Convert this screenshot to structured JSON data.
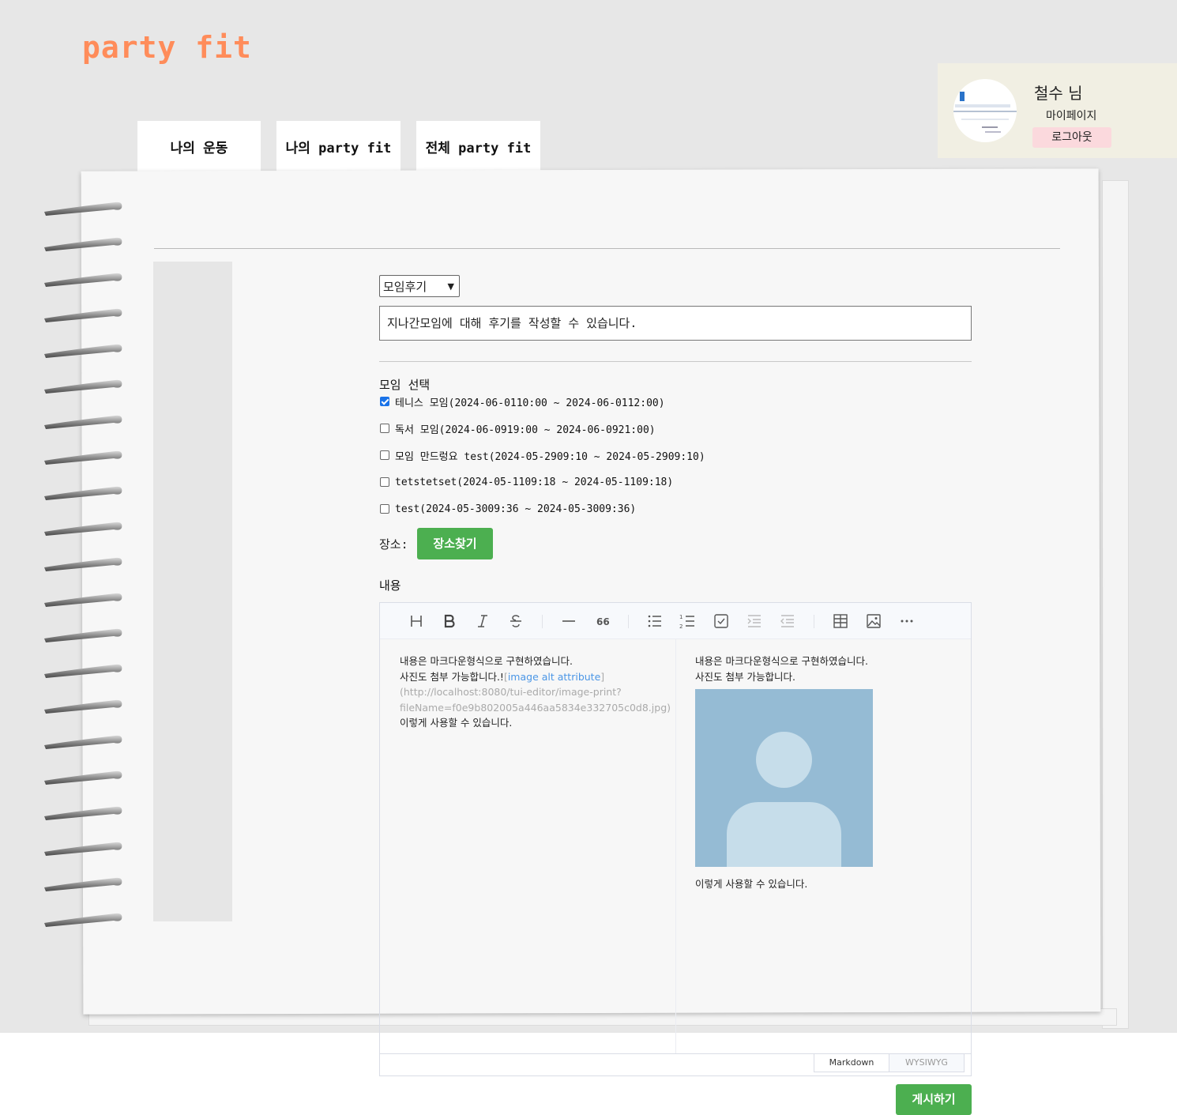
{
  "brand": {
    "logo": "party fit",
    "accent_color": "#ff8c5a"
  },
  "profile": {
    "name": "철수 님",
    "mypage_label": "마이페이지",
    "logout_label": "로그아웃"
  },
  "tabs": [
    {
      "label": "나의 운동"
    },
    {
      "label": "나의 party fit"
    },
    {
      "label": "전체 party fit"
    }
  ],
  "form": {
    "category": {
      "selected": "모임후기"
    },
    "title_value": "지나간모임에 대해 후기를 작성할 수 있습니다.",
    "meeting_select_label": "모임 선택",
    "meetings": [
      {
        "label": "테니스 모임(2024-06-0110:00 ~ 2024-06-0112:00)",
        "checked": true
      },
      {
        "label": "독서 모임(2024-06-0919:00 ~ 2024-06-0921:00)",
        "checked": false
      },
      {
        "label": "모임 만드렁요 test(2024-05-2909:10 ~ 2024-05-2909:10)",
        "checked": false
      },
      {
        "label": "tetstetset(2024-05-1109:18 ~ 2024-05-1109:18)",
        "checked": false
      },
      {
        "label": "test(2024-05-3009:36 ~ 2024-05-3009:36)",
        "checked": false
      }
    ],
    "place_label": "장소:",
    "place_button": "장소찾기",
    "content_label": "내용",
    "submit_button": "게시하기"
  },
  "editor": {
    "toolbar_icons": [
      "heading-icon",
      "bold-icon",
      "italic-icon",
      "strike-icon",
      "hr-icon",
      "quote-icon",
      "bullet-list-icon",
      "ordered-list-icon",
      "task-list-icon",
      "indent-icon",
      "outdent-icon",
      "table-icon",
      "image-icon",
      "more-icon"
    ],
    "markdown": {
      "line1": "내용은 마크다운형식으로 구현하였습니다.",
      "line2_text": "사진도 첨부 가능합니다.!",
      "open_bracket": "[",
      "alt_text": "image alt attribute",
      "close_bracket": "]",
      "url_line1": "(http://localhost:8080/tui-editor/image-print?",
      "url_line2": "fileName=f0e9b802005a446aa5834e332705c0d8.jpg)",
      "line_last": "이렇게 사용할 수 있습니다."
    },
    "preview": {
      "line1": "내용은 마크다운형식으로 구현하였습니다.",
      "line2": "사진도 첨부 가능합니다.",
      "line_last": "이렇게 사용할 수 있습니다."
    },
    "modes": {
      "markdown": "Markdown",
      "wysiwyg": "WYSIWYG"
    }
  }
}
